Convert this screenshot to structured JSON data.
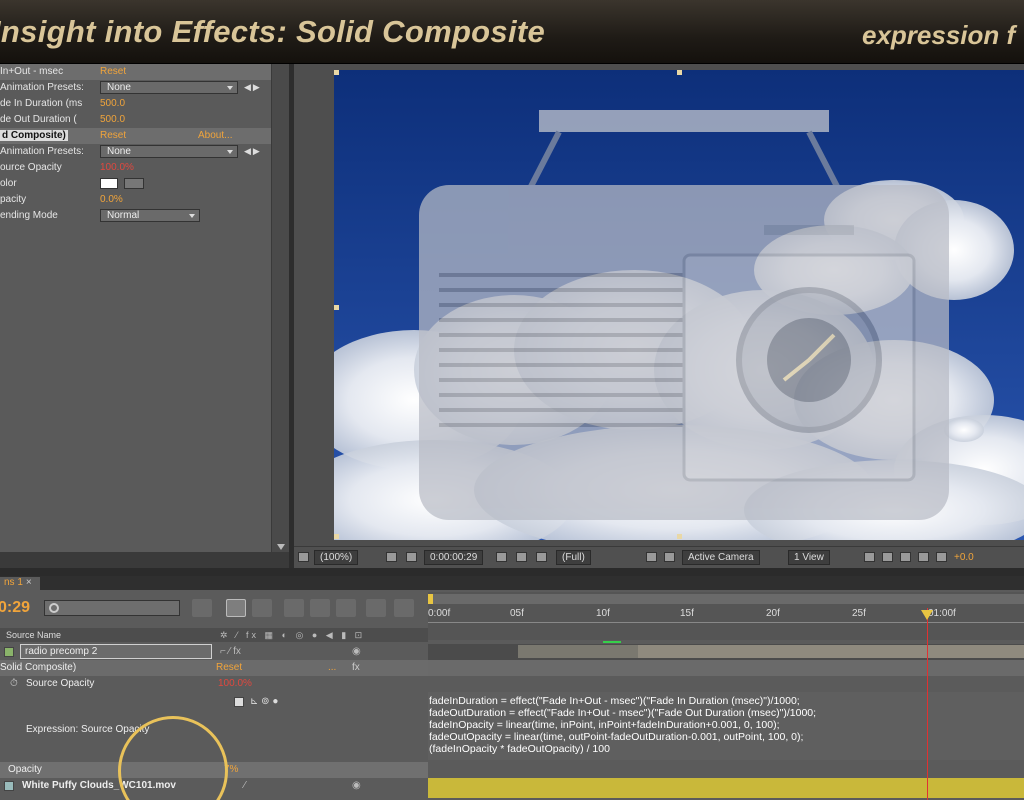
{
  "banner": {
    "title": "Insight into Effects: Solid Composite",
    "brand": "expression f"
  },
  "effect_controls": {
    "rows": [
      {
        "label": "In+Out - msec",
        "value": "Reset"
      },
      {
        "label": "Animation Presets:",
        "preset": "None"
      },
      {
        "label": "de In Duration (ms",
        "value": "500.0"
      },
      {
        "label": "de Out Duration (",
        "value": "500.0"
      },
      {
        "label": "d Composite)",
        "value": "Reset",
        "extra": "About..."
      },
      {
        "label": "Animation Presets:",
        "preset": "None"
      },
      {
        "label": "ource Opacity",
        "value": "100.0%"
      },
      {
        "label": "olor"
      },
      {
        "label": "pacity",
        "value": "0.0%"
      },
      {
        "label": "ending Mode",
        "preset": "Normal"
      }
    ]
  },
  "viewer_toolbar": {
    "zoom": "(100%)",
    "timecode": "0:00:00:29",
    "resolution": "(Full)",
    "camera": "Active Camera",
    "view": "1 View",
    "exposure": "+0.0"
  },
  "timeline": {
    "tab": "ns 1",
    "tab_close": "×",
    "timecode": "0:29",
    "column_source_name": "Source Name",
    "ruler_ticks": [
      "0:00f",
      "05f",
      "10f",
      "15f",
      "20f",
      "25f",
      "01:00f"
    ],
    "rows": {
      "layer1_name": "radio precomp 2",
      "effect_name": "Solid Composite)",
      "effect_reset": "Reset",
      "effect_dots": "...",
      "prop_label": "Source Opacity",
      "prop_value": "100.0%",
      "expr_label": "Expression: Source Opacity",
      "opacity_label": "Opacity",
      "opacity_value": "7%",
      "layer2_name": "White Puffy Clouds_WC101.mov"
    },
    "expression": "fadeInDuration = effect(\"Fade In+Out - msec\")(\"Fade In Duration (msec)\")/1000;\nfadeOutDuration = effect(\"Fade In+Out - msec\")(\"Fade Out Duration (msec)\")/1000;\nfadeInOpacity = linear(time, inPoint, inPoint+fadeInDuration+0.001, 0, 100);\nfadeOutOpacity = linear(time, outPoint-fadeOutDuration-0.001, outPoint, 100, 0);\n(fadeInOpacity * fadeOutOpacity) / 100"
  },
  "colors": {
    "accent": "#f0a43b",
    "title": "#d9c598",
    "sky": "#123a8a",
    "playhead": "#e03232"
  }
}
